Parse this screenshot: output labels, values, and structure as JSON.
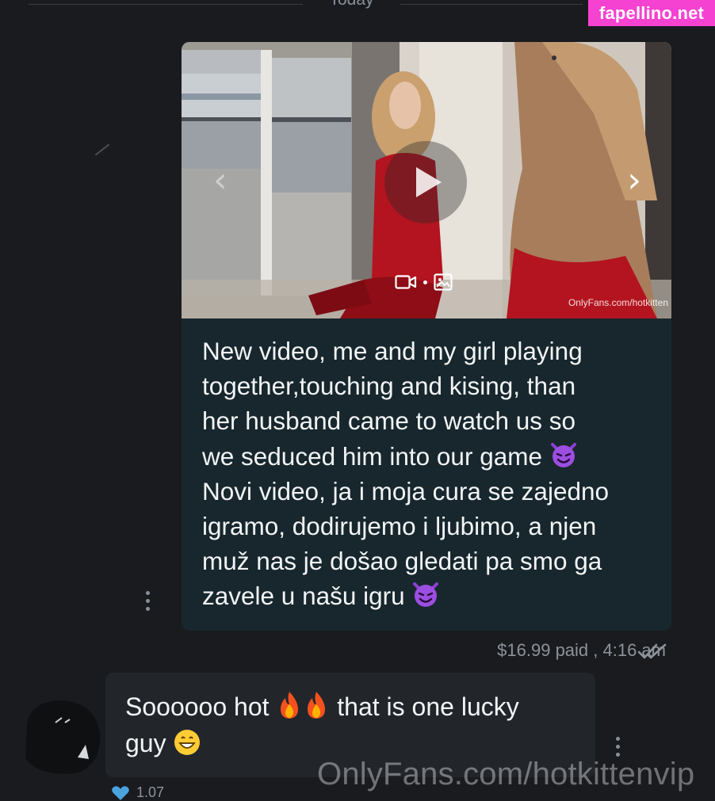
{
  "date_separator": "Today",
  "site_badge": "fapellino.net",
  "outgoing_message": {
    "media": {
      "source_watermark": "OnlyFans.com/hotkitten",
      "prev_icon": "chevron-left-icon",
      "next_icon": "chevron-right-icon",
      "play_icon": "play-icon",
      "meta_icons": [
        "video-camera-icon",
        "image-icon"
      ]
    },
    "text_lines": [
      "New video, me and my girl playing",
      "together,touching and kising, than",
      "her husband came to watch us so",
      "we seduced him into our game",
      "Novi video, ja i moja cura se zajedno",
      "igramo, dodirujemo i ljubimo, a njen",
      "muž nas je došao gledati pa smo ga",
      "zavele u našu igru"
    ],
    "status": "$16.99 paid ,  4:16 am",
    "read_icon": "double-check-icon",
    "background": "#17272d"
  },
  "incoming_message": {
    "text_line1": "Soooooo hot",
    "text_line1_end": "that is one lucky",
    "text_line2": "guy",
    "emoji": [
      "fire-emoji",
      "fire-emoji",
      "grinning-emoji"
    ],
    "like_count": "1.07"
  },
  "bottom_watermark": "OnlyFans.com/hotkittenvip",
  "colors": {
    "background": "#191b1f",
    "badge": "#f542d1",
    "incoming_bubble": "#22262b",
    "muted_text": "#8d939b"
  }
}
